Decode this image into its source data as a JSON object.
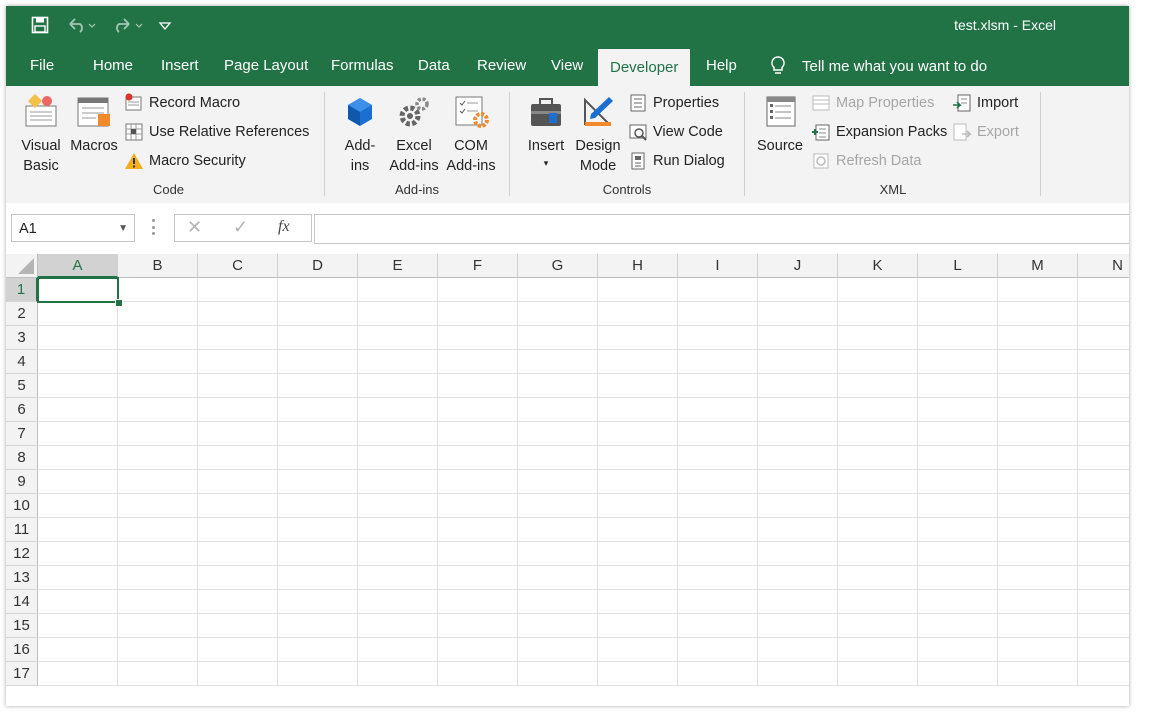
{
  "window": {
    "title": "test.xlsm  -  Excel",
    "accent": "#217346"
  },
  "quick_access": {
    "save_icon": "save-icon",
    "undo_icon": "undo-icon",
    "redo_icon": "redo-icon",
    "customize_icon": "customize-qat-icon"
  },
  "tabs": [
    {
      "label": "File"
    },
    {
      "label": "Home"
    },
    {
      "label": "Insert"
    },
    {
      "label": "Page Layout"
    },
    {
      "label": "Formulas"
    },
    {
      "label": "Data"
    },
    {
      "label": "Review"
    },
    {
      "label": "View"
    },
    {
      "label": "Developer",
      "active": true
    },
    {
      "label": "Help"
    }
  ],
  "tell_me": "Tell me what you want to do",
  "ribbon": {
    "code": {
      "label": "Code",
      "visual_basic_1": "Visual",
      "visual_basic_2": "Basic",
      "macros": "Macros",
      "record_macro": "Record Macro",
      "relative_refs": "Use Relative References",
      "macro_security": "Macro Security"
    },
    "addins": {
      "label": "Add-ins",
      "addins_1": "Add-",
      "addins_2": "ins",
      "excel_1": "Excel",
      "excel_2": "Add-ins",
      "com_1": "COM",
      "com_2": "Add-ins"
    },
    "controls": {
      "label": "Controls",
      "insert": "Insert",
      "design_1": "Design",
      "design_2": "Mode",
      "properties": "Properties",
      "view_code": "View Code",
      "run_dialog": "Run Dialog"
    },
    "xml": {
      "label": "XML",
      "source": "Source",
      "map_properties": "Map Properties",
      "expansion_packs": "Expansion Packs",
      "refresh_data": "Refresh Data",
      "import": "Import",
      "export": "Export"
    }
  },
  "formula_bar": {
    "name_box": "A1",
    "formula": "",
    "fx": "fx"
  },
  "grid": {
    "columns": [
      "A",
      "B",
      "C",
      "D",
      "E",
      "F",
      "G",
      "H",
      "I",
      "J",
      "K",
      "L",
      "M",
      "N"
    ],
    "rows": [
      "1",
      "2",
      "3",
      "4",
      "5",
      "6",
      "7",
      "8",
      "9",
      "10",
      "11",
      "12",
      "13",
      "14",
      "15",
      "16",
      "17"
    ],
    "active_cell": "A1"
  }
}
